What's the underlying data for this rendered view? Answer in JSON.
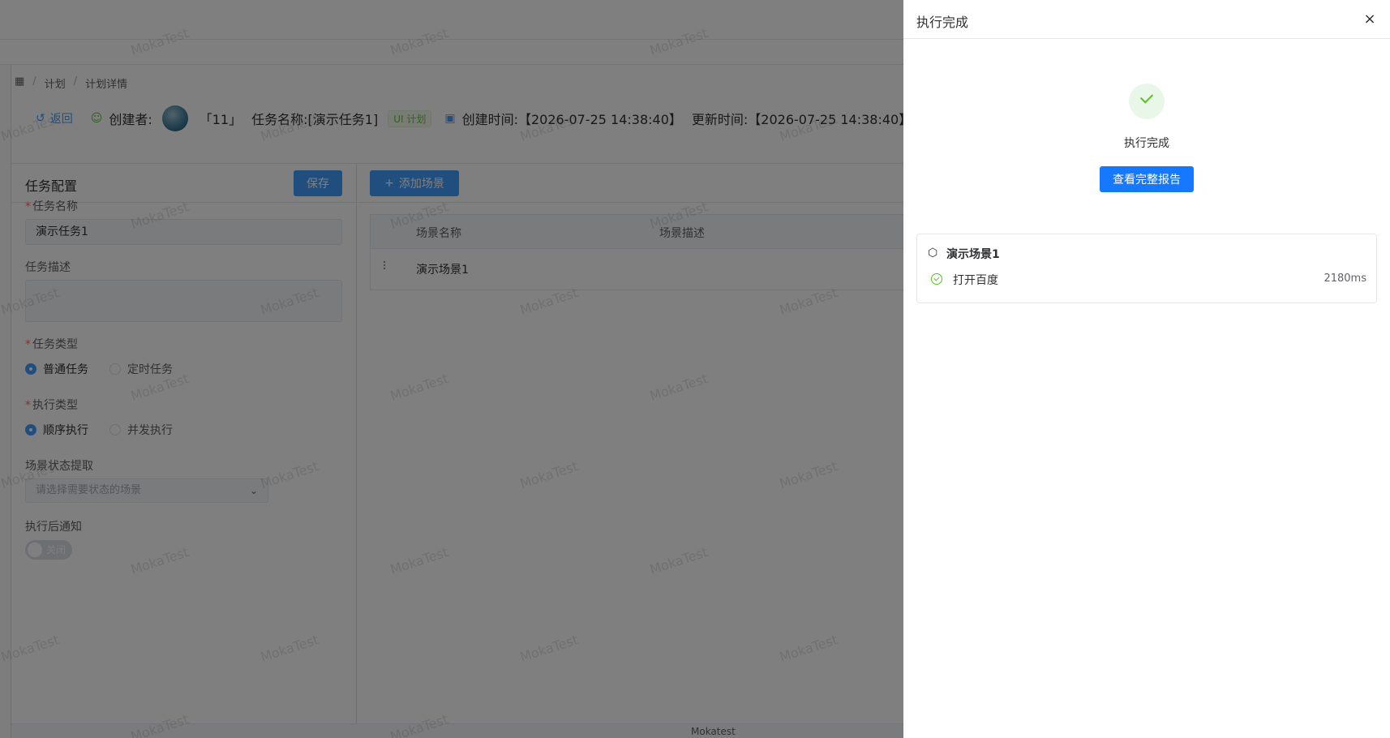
{
  "breadcrumb": {
    "root_icon": "grid-icon",
    "items": [
      "计划",
      "计划详情"
    ]
  },
  "info_bar": {
    "back_label": "返回",
    "creator_label": "创建者:",
    "task_id": "「11」",
    "task_name": "任务名称:[演示任务1]",
    "ui_tag": "UI 计划",
    "create_time": "创建时间:【2026-07-25 14:38:40】",
    "update_time": "更新时间:【2026-07-25 14:38:40】"
  },
  "config_panel": {
    "title": "任务配置",
    "save_label": "保存",
    "name_label": "任务名称",
    "name_value": "演示任务1",
    "desc_label": "任务描述",
    "type_label": "任务类型",
    "type_options": [
      "普通任务",
      "定时任务"
    ],
    "type_selected": "普通任务",
    "exec_label": "执行类型",
    "exec_options": [
      "顺序执行",
      "并发执行"
    ],
    "exec_selected": "顺序执行",
    "status_label": "场景状态提取",
    "status_placeholder": "请选择需要状态的场景",
    "notify_label": "执行后通知",
    "notify_switch_text": "关闭"
  },
  "scene_area": {
    "add_label": "添加场景",
    "columns": [
      "场景名称",
      "场景描述"
    ],
    "rows": [
      {
        "name": "演示场景1",
        "desc": ""
      }
    ]
  },
  "footer": {
    "text": "Mokatest"
  },
  "watermark": "MokaTest",
  "drawer": {
    "title": "执行完成",
    "result_text": "执行完成",
    "report_button": "查看完整报告",
    "scene_card": {
      "name": "演示场景1",
      "steps": [
        {
          "name": "打开百度",
          "duration": "2180ms",
          "status": "success"
        }
      ]
    }
  },
  "colors": {
    "primary": "#409eff",
    "drawer_primary": "#1677ff",
    "success": "#52c41a",
    "danger": "#f56c6c"
  }
}
